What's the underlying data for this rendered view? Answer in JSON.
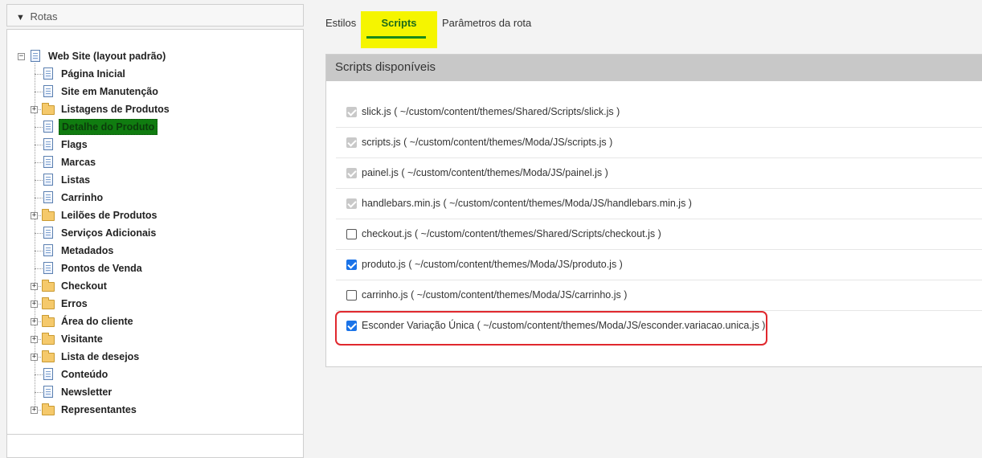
{
  "sidebar": {
    "header": "Rotas",
    "root": "Web Site (layout padrão)",
    "items": [
      {
        "label": "Página Inicial",
        "type": "doc"
      },
      {
        "label": "Site em Manutenção",
        "type": "doc"
      },
      {
        "label": "Listagens de Produtos",
        "type": "folder"
      },
      {
        "label": "Detalhe do Produto",
        "type": "doc",
        "selected": true
      },
      {
        "label": "Flags",
        "type": "doc"
      },
      {
        "label": "Marcas",
        "type": "doc"
      },
      {
        "label": "Listas",
        "type": "doc"
      },
      {
        "label": "Carrinho",
        "type": "doc"
      },
      {
        "label": "Leilões de Produtos",
        "type": "folder"
      },
      {
        "label": "Serviços Adicionais",
        "type": "doc"
      },
      {
        "label": "Metadados",
        "type": "doc"
      },
      {
        "label": "Pontos de Venda",
        "type": "doc"
      },
      {
        "label": "Checkout",
        "type": "folder"
      },
      {
        "label": "Erros",
        "type": "folder"
      },
      {
        "label": "Área do cliente",
        "type": "folder"
      },
      {
        "label": "Visitante",
        "type": "folder"
      },
      {
        "label": "Lista de desejos",
        "type": "folder"
      },
      {
        "label": "Conteúdo",
        "type": "doc"
      },
      {
        "label": "Newsletter",
        "type": "doc"
      },
      {
        "label": "Representantes",
        "type": "folder"
      }
    ]
  },
  "tabs": [
    {
      "label": "Estilos"
    },
    {
      "label": "Scripts",
      "active": true
    },
    {
      "label": "Parâmetros da rota"
    }
  ],
  "panel": {
    "title": "Scripts disponíveis",
    "scripts": [
      {
        "name": "slick.js",
        "path": "( ~/custom/content/themes/Shared/Scripts/slick.js )",
        "state": "disabled"
      },
      {
        "name": "scripts.js",
        "path": "( ~/custom/content/themes/Moda/JS/scripts.js )",
        "state": "disabled"
      },
      {
        "name": "painel.js",
        "path": "( ~/custom/content/themes/Moda/JS/painel.js )",
        "state": "disabled"
      },
      {
        "name": "handlebars.min.js",
        "path": "( ~/custom/content/themes/Moda/JS/handlebars.min.js )",
        "state": "disabled"
      },
      {
        "name": "checkout.js",
        "path": "( ~/custom/content/themes/Shared/Scripts/checkout.js )",
        "state": "unchecked"
      },
      {
        "name": "produto.js",
        "path": "( ~/custom/content/themes/Moda/JS/produto.js )",
        "state": "checked"
      },
      {
        "name": "carrinho.js",
        "path": "( ~/custom/content/themes/Moda/JS/carrinho.js )",
        "state": "unchecked"
      },
      {
        "name": "Esconder Variação Única",
        "path": "( ~/custom/content/themes/Moda/JS/esconder.variacao.unica.js )",
        "state": "checked"
      }
    ]
  }
}
